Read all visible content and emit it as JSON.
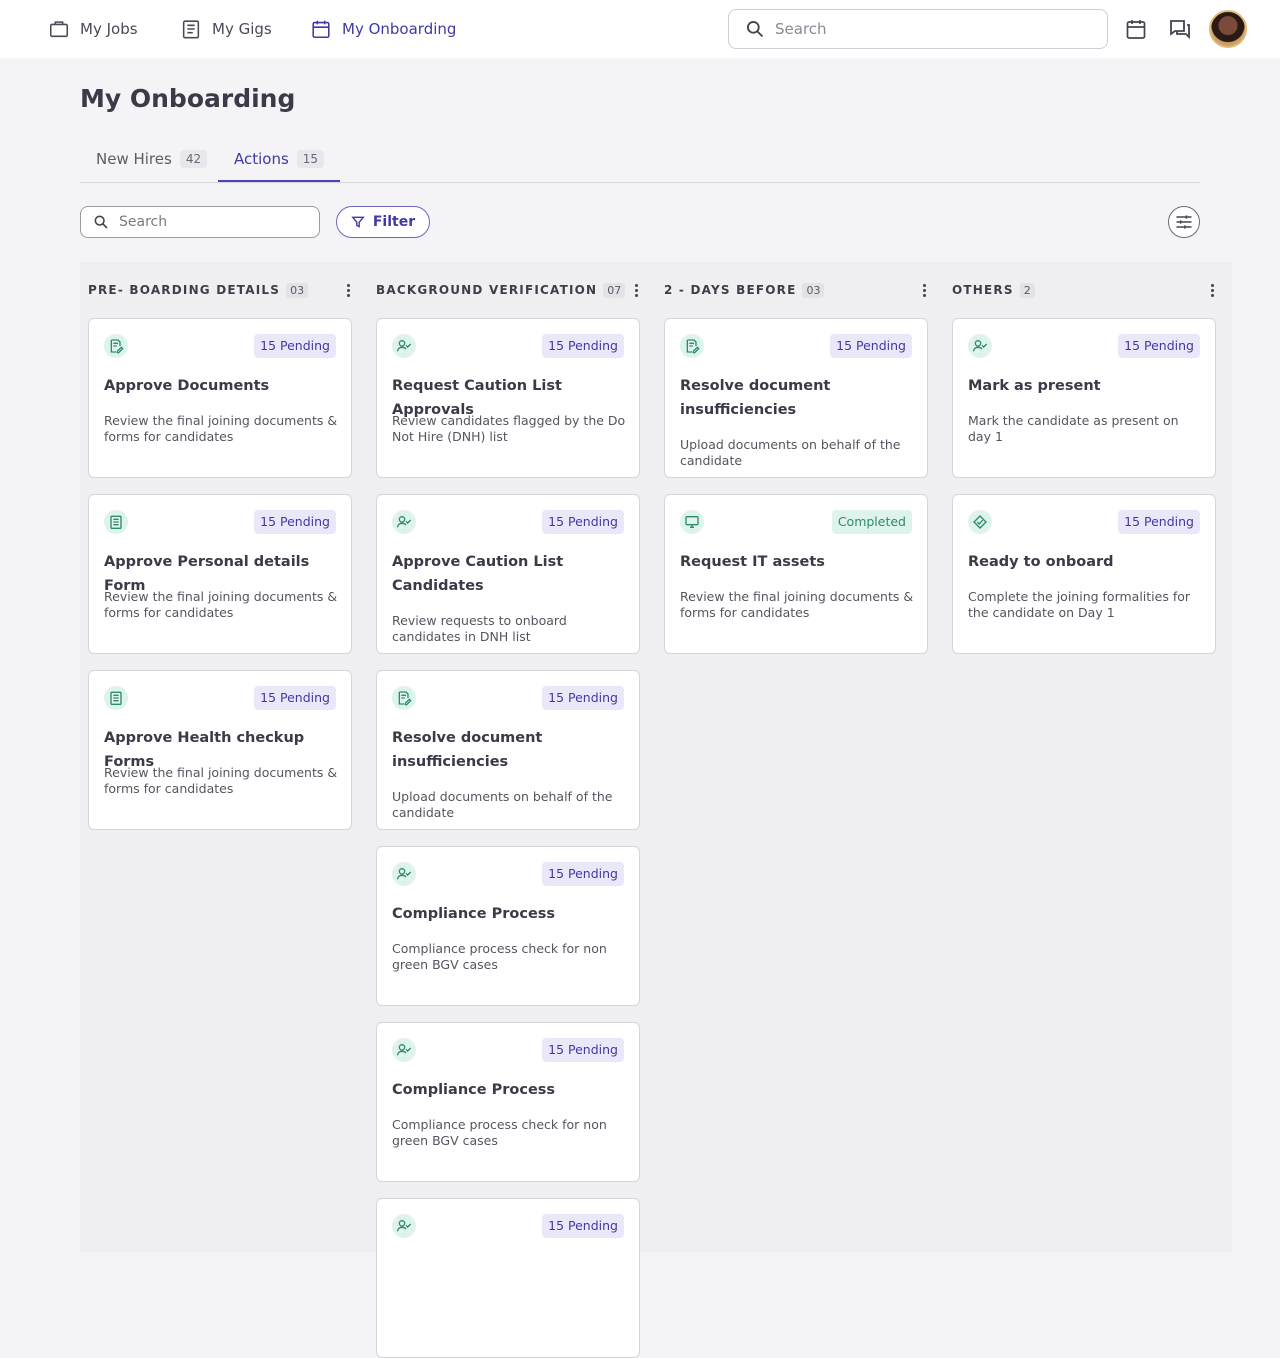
{
  "nav": {
    "items": [
      {
        "label": "My Jobs",
        "icon": "briefcase-icon"
      },
      {
        "label": "My Gigs",
        "icon": "clipboard-icon"
      },
      {
        "label": "My Onboarding",
        "icon": "calendar-icon",
        "active": true
      }
    ],
    "search_placeholder": "Search"
  },
  "page": {
    "title": "My Onboarding",
    "tabs": [
      {
        "label": "New Hires",
        "count": "42"
      },
      {
        "label": "Actions",
        "count": "15",
        "active": true
      }
    ],
    "search_placeholder": "Search",
    "filter_label": "Filter"
  },
  "columns": [
    {
      "title": "PRE- BOARDING DETAILS",
      "count": "03",
      "cards": [
        {
          "icon": "document-edit-icon",
          "badge": "15 Pending",
          "title": "Approve Documents",
          "desc": "Review the final joining documents & forms for candidates"
        },
        {
          "icon": "form-icon",
          "badge": "15 Pending",
          "title": "Approve Personal details Form",
          "desc": "Review the final joining documents & forms for candidates"
        },
        {
          "icon": "form-icon",
          "badge": "15 Pending",
          "title": "Approve Health checkup Forms",
          "desc": "Review the final joining documents & forms for candidates"
        }
      ]
    },
    {
      "title": "BACKGROUND VERIFICATION",
      "count": "07",
      "cards": [
        {
          "icon": "user-check-icon",
          "badge": "15 Pending",
          "title": "Request Caution List Approvals",
          "desc": "Review candidates flagged by the Do Not Hire (DNH) list"
        },
        {
          "icon": "user-check-icon",
          "badge": "15 Pending",
          "title": "Approve Caution List Candidates",
          "desc": "Review requests to onboard candidates in DNH list"
        },
        {
          "icon": "document-edit-icon",
          "badge": "15 Pending",
          "title": "Resolve document insufficiencies",
          "desc": "Upload documents on behalf of the candidate"
        },
        {
          "icon": "user-check-icon",
          "badge": "15 Pending",
          "title": "Compliance Process",
          "desc": "Compliance process check for non green BGV cases"
        },
        {
          "icon": "user-check-icon",
          "badge": "15 Pending",
          "title": "Compliance Process",
          "desc": "Compliance process check for non green BGV cases"
        },
        {
          "icon": "user-check-icon",
          "badge": "15 Pending",
          "title": "",
          "desc": ""
        }
      ]
    },
    {
      "title": "2 - DAYS BEFORE",
      "count": "03",
      "cards": [
        {
          "icon": "document-edit-icon",
          "badge": "15 Pending",
          "title": "Resolve document insufficiencies",
          "desc": "Upload documents on behalf of the candidate"
        },
        {
          "icon": "monitor-icon",
          "badge": "Completed",
          "completed": true,
          "title": "Request IT assets",
          "desc": "Review the final joining documents & forms for candidates"
        }
      ]
    },
    {
      "title": "OTHERS",
      "count": "2",
      "cards": [
        {
          "icon": "user-check-icon",
          "badge": "15 Pending",
          "title": "Mark as present",
          "desc": "Mark the candidate as present on day 1"
        },
        {
          "icon": "handshake-icon",
          "badge": "15 Pending",
          "title": "Ready to onboard",
          "desc": "Complete the joining formalities for the candidate on Day 1"
        }
      ]
    }
  ]
}
